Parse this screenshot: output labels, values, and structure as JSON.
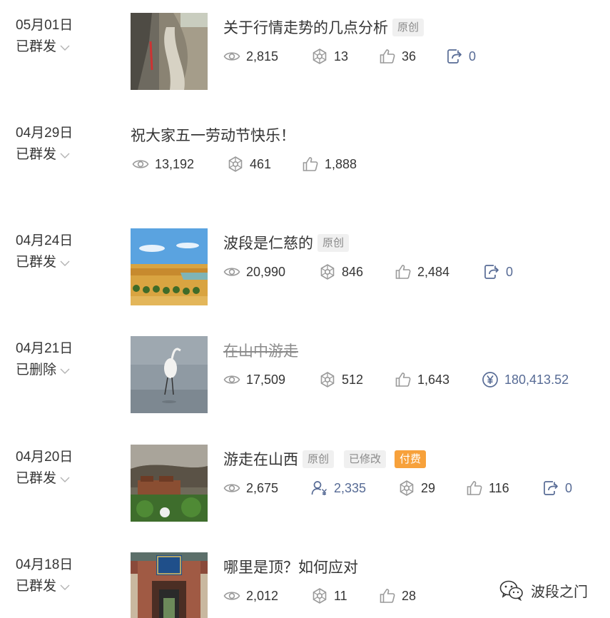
{
  "articles": [
    {
      "date": "05月01日",
      "status": "已群发",
      "title": "关于行情走势的几点分析",
      "tags": [
        "原创"
      ],
      "stats": {
        "views": "2,815",
        "shares": "13",
        "likes": "36",
        "forwards": "0"
      }
    },
    {
      "date": "04月29日",
      "status": "已群发",
      "title": "祝大家五一劳动节快乐！",
      "tags": [],
      "stats": {
        "views": "13,192",
        "shares": "461",
        "likes": "1,888"
      }
    },
    {
      "date": "04月24日",
      "status": "已群发",
      "title": "波段是仁慈的",
      "tags": [
        "原创"
      ],
      "stats": {
        "views": "20,990",
        "shares": "846",
        "likes": "2,484",
        "forwards": "0"
      }
    },
    {
      "date": "04月21日",
      "status": "已删除",
      "title": "在山中游走",
      "tags": [],
      "stats": {
        "views": "17,509",
        "shares": "512",
        "likes": "1,643",
        "revenue": "180,413.52"
      }
    },
    {
      "date": "04月20日",
      "status": "已群发",
      "title": "游走在山西",
      "tags": [
        "原创",
        "已修改"
      ],
      "paid_tag": "付费",
      "stats": {
        "views": "2,675",
        "paid_readers": "2,335",
        "shares": "29",
        "likes": "116",
        "forwards": "0"
      }
    },
    {
      "date": "04月18日",
      "status": "已群发",
      "title": "哪里是顶？如何应对",
      "tags": [],
      "stats": {
        "views": "2,012",
        "shares": "11",
        "likes": "28"
      }
    }
  ],
  "watermark": {
    "text": "波段之门"
  },
  "colors": {
    "text": "#353535",
    "muted": "#8a8a8a",
    "link_blue": "#576b95",
    "paid_orange": "#f7a13b",
    "tag_bg": "#f0f0f0"
  }
}
